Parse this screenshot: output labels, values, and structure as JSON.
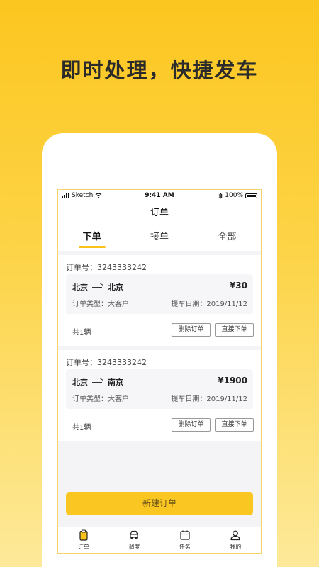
{
  "headline": "即时处理，快捷发车",
  "status_bar": {
    "carrier": "Sketch",
    "time": "9:41 AM",
    "battery": "100%"
  },
  "nav_title": "订单",
  "tabs": [
    {
      "label": "下单",
      "active": true
    },
    {
      "label": "接单",
      "active": false
    },
    {
      "label": "全部",
      "active": false
    }
  ],
  "orders": [
    {
      "order_no": "订单号：3243333242",
      "from": "北京",
      "to": "北京",
      "price": "¥30",
      "type": "订单类型：大客户",
      "pickup_date": "提车日期：2019/11/12",
      "count": "共1辆",
      "delete_label": "删除订单",
      "direct_label": "直接下单"
    },
    {
      "order_no": "订单号：3243333242",
      "from": "北京",
      "to": "南京",
      "price": "¥1900",
      "type": "订单类型：大客户",
      "pickup_date": "提车日期：2019/11/12",
      "count": "共1辆",
      "delete_label": "删除订单",
      "direct_label": "直接下单"
    }
  ],
  "new_order_label": "新建订单",
  "bottom_nav": [
    {
      "label": "订单",
      "icon": "clipboard-icon",
      "active": true
    },
    {
      "label": "调度",
      "icon": "car-icon",
      "active": false
    },
    {
      "label": "任务",
      "icon": "calendar-icon",
      "active": false
    },
    {
      "label": "我的",
      "icon": "user-icon",
      "active": false
    }
  ],
  "colors": {
    "accent": "#f8c21a",
    "background_top": "#fcc61f",
    "background_bottom": "#fde99a"
  }
}
